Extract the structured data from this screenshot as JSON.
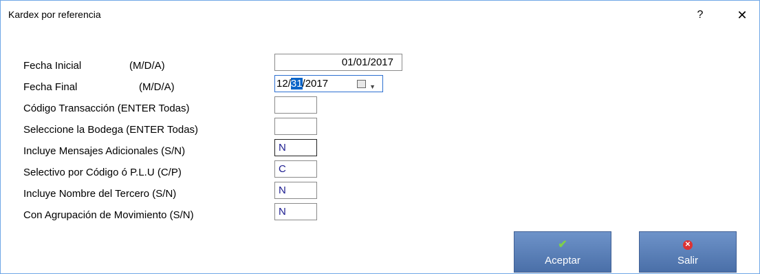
{
  "window": {
    "title": "Kardex por referencia",
    "help_label": "?",
    "close_label": "✕"
  },
  "form": {
    "rows": [
      {
        "label": "Fecha Inicial",
        "hint": "(M/D/A)",
        "value": "01/01/2017"
      },
      {
        "label": "Fecha Final",
        "hint": "(M/D/A)",
        "value_pre": "12/",
        "value_sel": "31",
        "value_post": "/2017"
      },
      {
        "label": "Código Transacción  (ENTER Todas)",
        "value": ""
      },
      {
        "label": "Seleccione la Bodega (ENTER Todas)",
        "value": ""
      },
      {
        "label": "Incluye Mensajes Adicionales (S/N)",
        "value": "N"
      },
      {
        "label": "Selectivo por Código ó P.L.U (C/P)",
        "value": "C"
      },
      {
        "label": "Incluye Nombre del Tercero  (S/N)",
        "value": "N"
      },
      {
        "label": "Con Agrupación de Movimiento (S/N)",
        "value": "N"
      }
    ]
  },
  "buttons": {
    "accept_label": "Aceptar",
    "exit_label": "Salir"
  },
  "icons": {
    "accept": "check-icon",
    "exit": "x-circle-icon",
    "calendar": "calendar-icon"
  }
}
